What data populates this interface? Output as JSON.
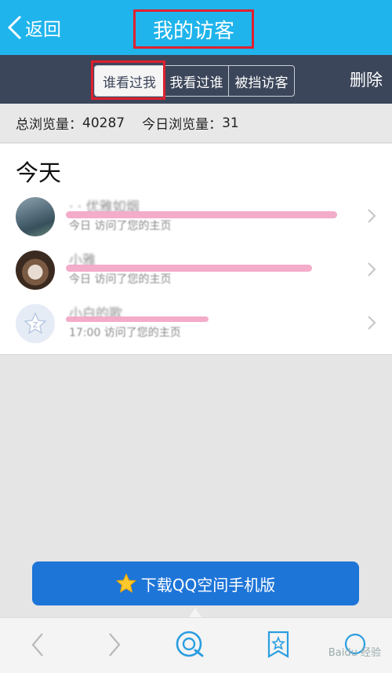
{
  "header": {
    "back_label": "返回",
    "title": "我的访客"
  },
  "tabs": [
    {
      "label": "谁看过我",
      "active": true
    },
    {
      "label": "我看过谁",
      "active": false
    },
    {
      "label": "被挡访客",
      "active": false
    }
  ],
  "delete_label": "删除",
  "stats": {
    "total_label": "总浏览量：",
    "total_value": "40287",
    "today_label": "今日浏览量：",
    "today_value": "31"
  },
  "section_title": "今天",
  "visitors": [
    {
      "name": "· · 优雅如烟",
      "subtitle": "今日 访问了您的主页",
      "avatar_icon": "landscape-avatar"
    },
    {
      "name": "小雅",
      "subtitle": "今日 访问了您的主页",
      "avatar_icon": "portrait-avatar"
    },
    {
      "name": "小白的歌",
      "subtitle": "17:00 访问了您的主页",
      "avatar_icon": "default-star-avatar"
    }
  ],
  "download_button": {
    "label": "下载QQ空间手机版",
    "icon": "star-icon"
  },
  "bottom_nav": [
    "back-arrow-icon",
    "forward-arrow-icon",
    "qzone-icon",
    "bookmark-star-icon",
    "refresh-icon"
  ],
  "watermark": "Baidu 经验",
  "colors": {
    "header_bg": "#20b4ec",
    "subbar_bg": "#3c465a",
    "highlight_red": "#e0202e",
    "download_bg": "#1e75d8",
    "scribble_pink": "#f2a8c6"
  }
}
